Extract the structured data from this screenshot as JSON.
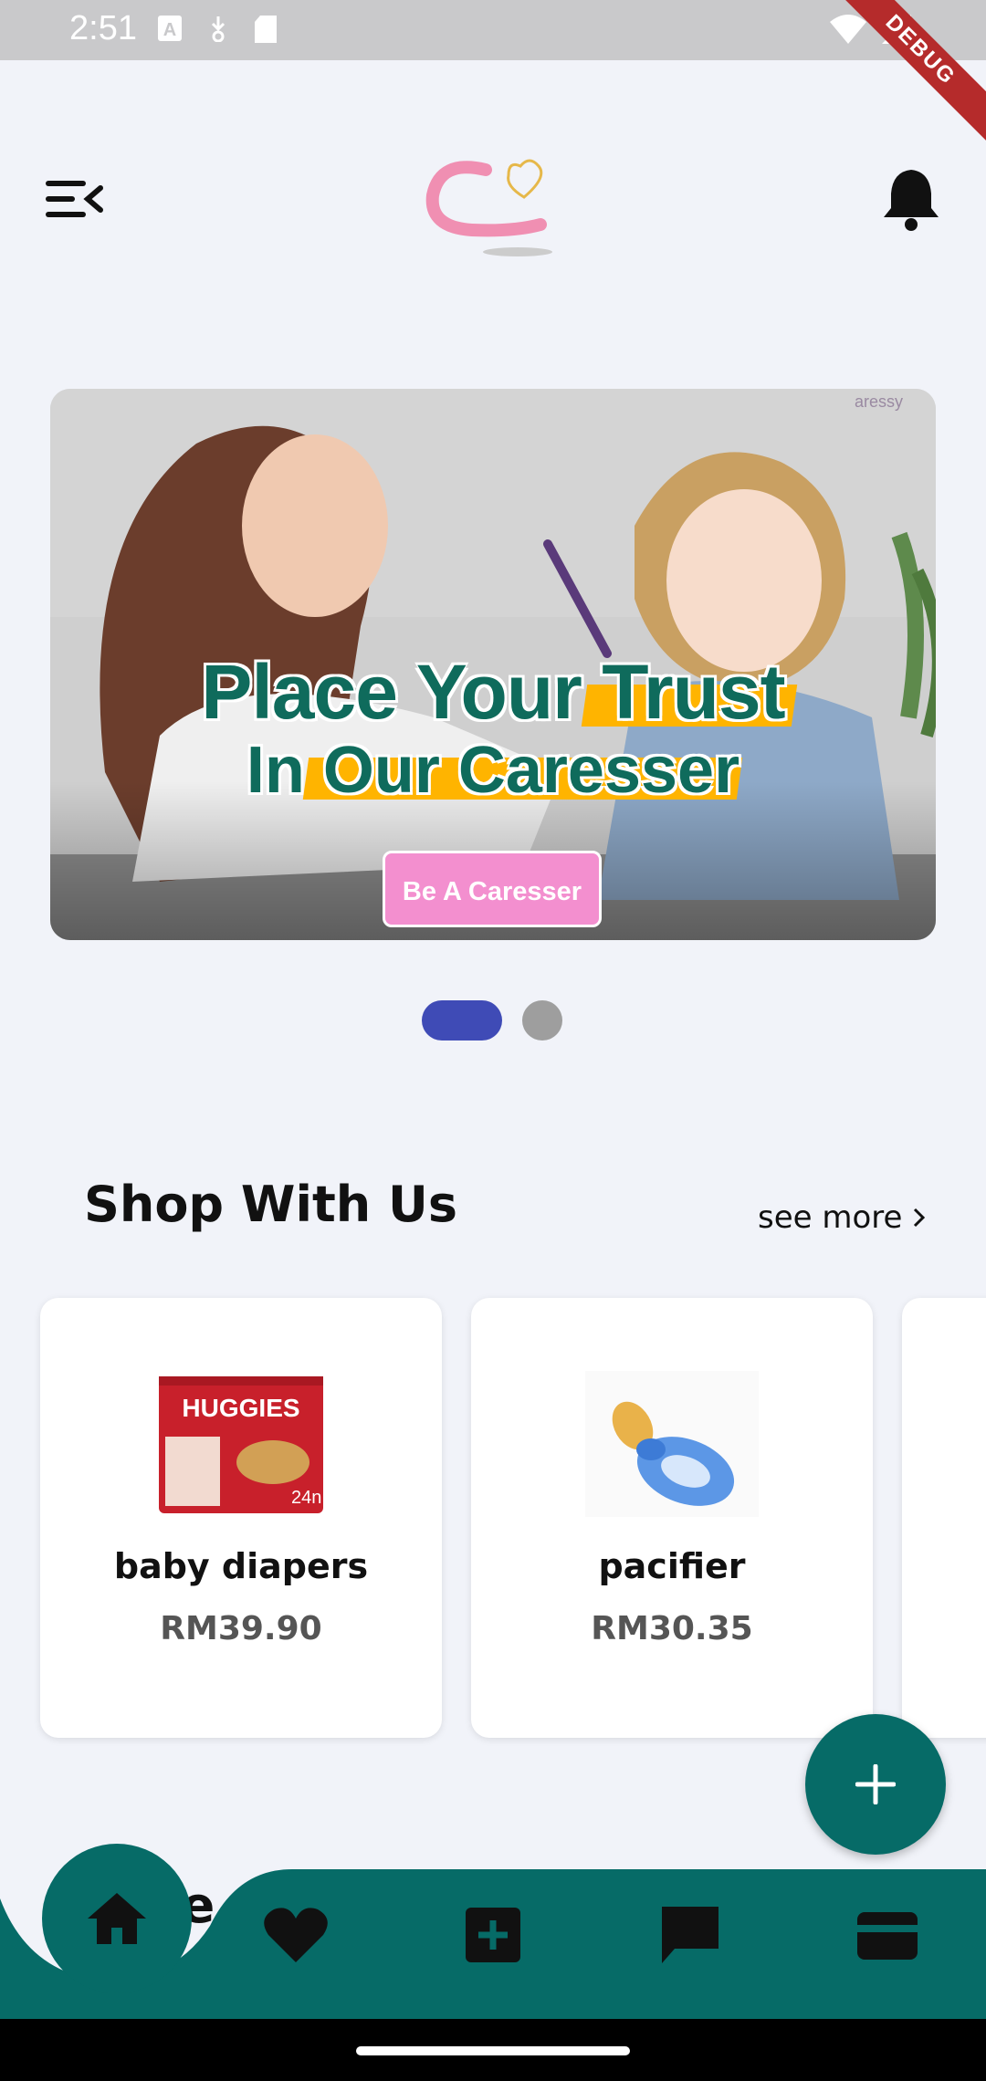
{
  "status_bar": {
    "time": "2:51",
    "debug_label": "DEBUG",
    "icons_left": [
      "text-a-icon",
      "download-icon",
      "sd-card-icon"
    ],
    "icons_right": [
      "wifi-icon",
      "signal-icon"
    ]
  },
  "header": {
    "menu_icon": "menu-collapse-icon",
    "logo_icon": "caressy-logo",
    "notification_icon": "bell-icon"
  },
  "banner": {
    "brand": "aressy",
    "title_line1": "Place Your Trust",
    "title_line2": "In Our Caresser",
    "cta_label": "Be A Caresser",
    "colors": {
      "title": "#0f6b5c",
      "highlight": "#ffb400",
      "cta": "#f38fcf"
    }
  },
  "carousel": {
    "active_index": 0,
    "count": 2
  },
  "shop_section": {
    "title": "Shop With Us",
    "see_more_label": "see more",
    "products": [
      {
        "name": "baby diapers",
        "price": "RM39.90",
        "image_label": "HUGGIES"
      },
      {
        "name": "pacifier",
        "price": "RM30.35"
      }
    ]
  },
  "second_section": {
    "title_fragment": "re"
  },
  "bottom_nav": {
    "items": [
      {
        "icon": "home-icon",
        "active": true
      },
      {
        "icon": "heart-icon"
      },
      {
        "icon": "add-box-icon"
      },
      {
        "icon": "chat-icon"
      },
      {
        "icon": "wallet-icon"
      }
    ],
    "color": "#066b67"
  },
  "fab": {
    "icon": "plus-icon"
  }
}
